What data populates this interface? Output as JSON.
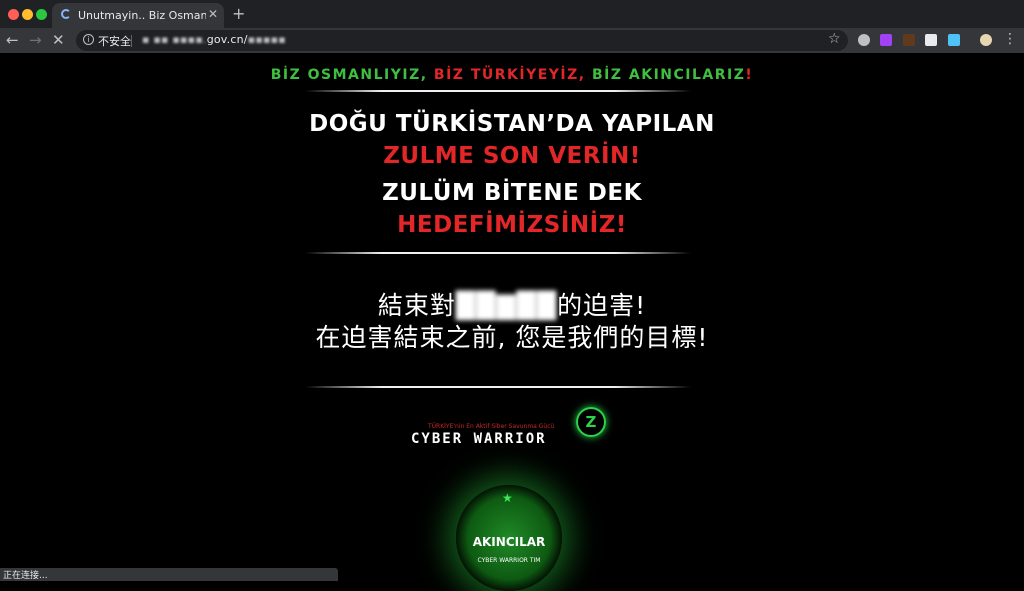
{
  "browser": {
    "tab_title": "Unutmayin.. Biz Osmanli'yiz, B",
    "tab_close": "✕",
    "new_tab": "+",
    "security_label": "不安全",
    "url_visible_part": "gov.cn/",
    "status_text": "正在连接..."
  },
  "page": {
    "slogan_part1": "BİZ OSMANLIYIZ, ",
    "slogan_part2": "BİZ TÜRKİYEYİZ, ",
    "slogan_part3": "BİZ AKINCILARIZ",
    "slogan_part4": "!",
    "line1": "DOĞU TÜRKİSTAN’DA YAPILAN",
    "line2": "ZULME SON VERİN!",
    "line3": "ZULÜM BİTENE DEK",
    "line4": "HEDEFİMİZSİNİZ!",
    "cn_line1_start": "結束對",
    "cn_line1_end": "的迫害!",
    "cn_line2": "在迫害結束之前, 您是我們的目標!",
    "cw_tagline": "TÜRKİYE'nin En Aktif Siber Savunma Gücü",
    "cw_title": "CYBER WARRIOR",
    "emblem_name": "AKINCILAR",
    "emblem_sub": "CYBER WARRIOR TIM"
  },
  "colors": {
    "red": "#e32628",
    "green": "#3fbf3f",
    "background": "#000000"
  }
}
